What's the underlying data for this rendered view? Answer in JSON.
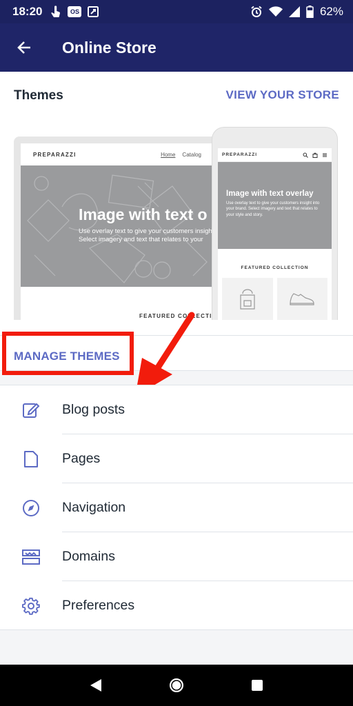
{
  "status_bar": {
    "time": "18:20",
    "os_badge": "OS",
    "battery": "62%"
  },
  "app_bar": {
    "title": "Online Store"
  },
  "themes": {
    "title": "Themes",
    "view_store": "VIEW YOUR STORE",
    "manage": "MANAGE THEMES",
    "preview": {
      "brand": "PREPARAZZI",
      "nav_home": "Home",
      "nav_catalog": "Catalog",
      "laptop_hero_title": "Image with text o",
      "laptop_hero_line1": "Use overlay text to give your customers insight",
      "laptop_hero_line2": "Select imagery and text that relates to your",
      "laptop_featured": "FEATURED COLLECTION",
      "phone_hero_title": "Image with text overlay",
      "phone_hero_sub": "Use overlay text to give your customers insight into your brand. Select imagery and text that relates to your style and story.",
      "phone_featured": "FEATURED COLLECTION"
    }
  },
  "menu": {
    "items": [
      {
        "label": "Blog posts",
        "icon": "blog-icon"
      },
      {
        "label": "Pages",
        "icon": "page-icon"
      },
      {
        "label": "Navigation",
        "icon": "compass-icon"
      },
      {
        "label": "Domains",
        "icon": "domain-icon"
      },
      {
        "label": "Preferences",
        "icon": "gear-icon"
      }
    ]
  },
  "colors": {
    "header": "#1f2568",
    "accent": "#5c6ac4",
    "highlight": "#f21c0c"
  }
}
